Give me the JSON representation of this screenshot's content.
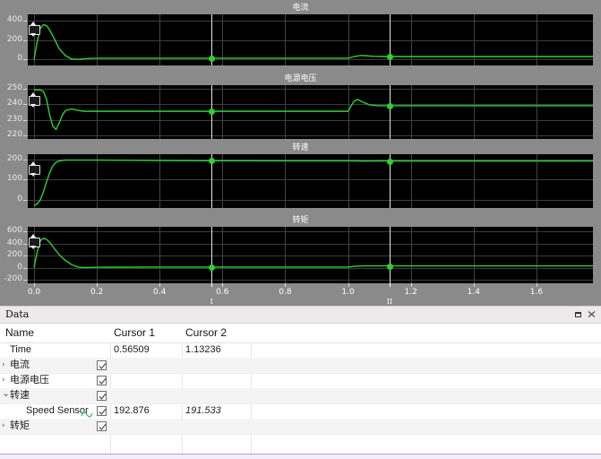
{
  "plots": [
    {
      "title": "电流",
      "y_ticks": [
        "400",
        "200",
        "0"
      ],
      "ylim": [
        -60,
        460
      ],
      "color": "#2fd12f"
    },
    {
      "title": "电源电压",
      "y_ticks": [
        "250",
        "240",
        "230",
        "220"
      ],
      "ylim": [
        218,
        252
      ],
      "color": "#2fd12f"
    },
    {
      "title": "转速",
      "y_ticks": [
        "200",
        "100",
        "0"
      ],
      "ylim": [
        -40,
        225
      ],
      "color": "#2fd12f"
    },
    {
      "title": "转矩",
      "y_ticks": [
        "600",
        "400",
        "200",
        "0",
        "-200"
      ],
      "ylim": [
        -260,
        680
      ],
      "color": "#2fd12f"
    }
  ],
  "xaxis": {
    "ticks": [
      "0.0",
      "0.2",
      "0.4",
      "0.6",
      "0.8",
      "1.0",
      "1.2",
      "1.4",
      "1.6"
    ],
    "values": [
      0.0,
      0.2,
      0.4,
      0.6,
      0.8,
      1.0,
      1.2,
      1.4,
      1.6
    ],
    "min": -0.02,
    "max": 1.78
  },
  "cursors": [
    {
      "label": "I",
      "time": 0.56509
    },
    {
      "label": "II",
      "time": 1.13236
    }
  ],
  "chart_data": {
    "type": "line",
    "title": "",
    "xlabel": "",
    "panels": [
      {
        "title": "电流",
        "ylabel": "",
        "ylim": [
          -60,
          460
        ],
        "yticks": [
          0,
          200,
          400
        ],
        "grid": true,
        "series": [
          {
            "name": "电流",
            "color": "#2fd12f",
            "x": [
              0.0,
              0.01,
              0.02,
              0.03,
              0.04,
              0.05,
              0.06,
              0.07,
              0.08,
              0.1,
              0.12,
              0.14,
              0.16,
              0.18,
              0.2,
              0.3,
              0.5,
              0.56509,
              0.8,
              1.0,
              1.02,
              1.04,
              1.06,
              1.08,
              1.12,
              1.13236,
              1.3,
              1.5,
              1.78
            ],
            "y": [
              0,
              180,
              320,
              355,
              345,
              300,
              240,
              175,
              110,
              40,
              5,
              2,
              8,
              12,
              14,
              14,
              14,
              14,
              14,
              14,
              30,
              42,
              38,
              33,
              30,
              30,
              30,
              30,
              30
            ]
          }
        ]
      },
      {
        "title": "电源电压",
        "ylabel": "",
        "ylim": [
          218,
          252
        ],
        "yticks": [
          220,
          230,
          240,
          250
        ],
        "grid": true,
        "series": [
          {
            "name": "电源电压",
            "color": "#2fd12f",
            "x": [
              0.0,
              0.01,
              0.02,
              0.03,
              0.04,
              0.05,
              0.06,
              0.07,
              0.08,
              0.09,
              0.1,
              0.12,
              0.14,
              0.16,
              0.2,
              0.3,
              0.5,
              0.56509,
              0.8,
              1.0,
              1.01,
              1.02,
              1.03,
              1.05,
              1.07,
              1.1,
              1.13236,
              1.3,
              1.5,
              1.78
            ],
            "y": [
              249,
              249,
              249,
              248,
              243,
              233,
              226,
              224,
              228,
              233,
              236,
              237,
              236,
              235.5,
              235.5,
              235.5,
              235.5,
              235.5,
              235.5,
              235.5,
              239,
              242,
              243,
              241,
              239.5,
              239,
              239,
              239,
              239,
              239
            ]
          }
        ]
      },
      {
        "title": "转速",
        "ylabel": "",
        "ylim": [
          -40,
          225
        ],
        "yticks": [
          0,
          100,
          200
        ],
        "grid": true,
        "series": [
          {
            "name": "Speed Sensor",
            "color": "#2fd12f",
            "x": [
              0.0,
              0.01,
              0.02,
              0.03,
              0.04,
              0.05,
              0.06,
              0.07,
              0.08,
              0.1,
              0.12,
              0.14,
              0.2,
              0.4,
              0.56509,
              0.8,
              1.0,
              1.05,
              1.13236,
              1.4,
              1.78
            ],
            "y": [
              -28,
              -20,
              0,
              40,
              90,
              135,
              168,
              185,
              192,
              196,
              196,
              196,
              196,
              194,
              192.876,
              192,
              192,
              191,
              191.533,
              191.5,
              191.5
            ]
          }
        ]
      },
      {
        "title": "转矩",
        "ylabel": "",
        "ylim": [
          -260,
          680
        ],
        "yticks": [
          -200,
          0,
          200,
          400,
          600
        ],
        "grid": true,
        "series": [
          {
            "name": "转矩",
            "color": "#2fd12f",
            "x": [
              0.0,
              0.01,
              0.02,
              0.03,
              0.04,
              0.05,
              0.06,
              0.08,
              0.1,
              0.12,
              0.14,
              0.16,
              0.2,
              0.4,
              0.56509,
              0.8,
              1.0,
              1.02,
              1.05,
              1.13236,
              1.4,
              1.78
            ],
            "y": [
              0,
              260,
              450,
              490,
              470,
              420,
              350,
              215,
              120,
              50,
              10,
              2,
              8,
              10,
              10,
              10,
              10,
              22,
              30,
              30,
              30,
              30
            ]
          }
        ]
      }
    ]
  },
  "panel": {
    "title": "Data",
    "float_icon": "float-icon",
    "close_icon": "close-icon"
  },
  "table": {
    "columns": [
      "Name",
      "Cursor 1",
      "Cursor 2"
    ],
    "rows": [
      {
        "indent": 0,
        "expander": "",
        "name": "Time",
        "checkbox": false,
        "checked": false,
        "wave": false,
        "c1": "0.56509",
        "c2": "1.13236",
        "italic_c2": false
      },
      {
        "indent": 0,
        "expander": "collapsed",
        "name": "电流",
        "checkbox": true,
        "checked": true,
        "wave": false,
        "c1": "",
        "c2": "",
        "italic_c2": false
      },
      {
        "indent": 0,
        "expander": "collapsed",
        "name": "电源电压",
        "checkbox": true,
        "checked": true,
        "wave": false,
        "c1": "",
        "c2": "",
        "italic_c2": false
      },
      {
        "indent": 0,
        "expander": "expanded",
        "name": "转速",
        "checkbox": true,
        "checked": true,
        "wave": false,
        "c1": "",
        "c2": "",
        "italic_c2": false
      },
      {
        "indent": 1,
        "expander": "",
        "name": "Speed Sensor",
        "checkbox": true,
        "checked": true,
        "wave": true,
        "c1": "192.876",
        "c2": "191.533",
        "italic_c2": true
      },
      {
        "indent": 0,
        "expander": "collapsed",
        "name": "转矩",
        "checkbox": true,
        "checked": true,
        "wave": false,
        "c1": "",
        "c2": "",
        "italic_c2": false
      }
    ]
  },
  "colors": {
    "plot_background": "#000000",
    "panel_background": "#8a8a8a",
    "trace": "#2fd12f",
    "cursor": "#e8e8e8",
    "grid": "#444444",
    "accent_bottom": "#b89ec6"
  }
}
